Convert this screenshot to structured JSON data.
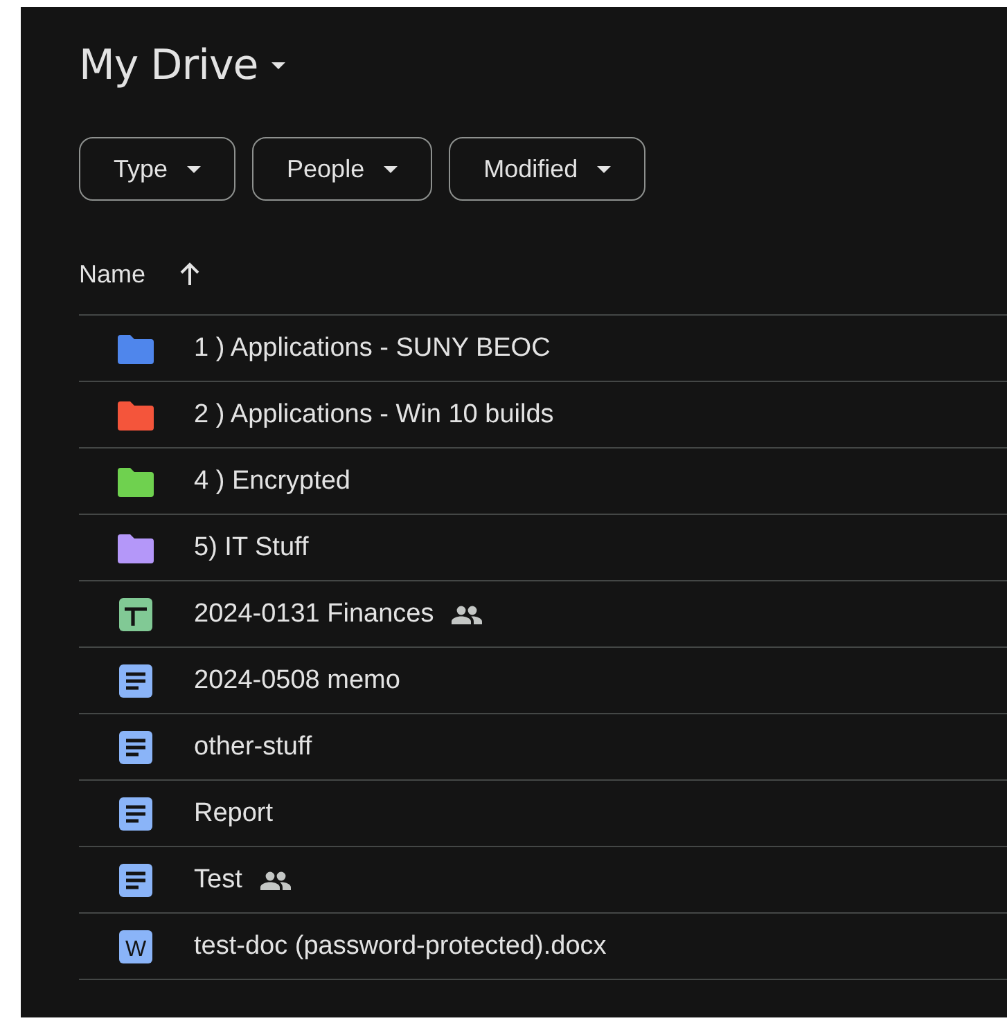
{
  "title": "My Drive",
  "filters": [
    {
      "label": "Type"
    },
    {
      "label": "People"
    },
    {
      "label": "Modified"
    }
  ],
  "table": {
    "columns": [
      {
        "label": "Name",
        "sort_ascending": true
      }
    ],
    "rows": [
      {
        "name": "1 ) Applications - SUNY BEOC",
        "kind": "folder",
        "color": "#4f86ec",
        "shared": false
      },
      {
        "name": "2 ) Applications - Win 10 builds",
        "kind": "folder",
        "color": "#f4553b",
        "shared": false
      },
      {
        "name": "4 ) Encrypted",
        "kind": "folder",
        "color": "#6fd14f",
        "shared": false
      },
      {
        "name": "5) IT Stuff",
        "kind": "folder",
        "color": "#b497f9",
        "shared": false
      },
      {
        "name": "2024-0131 Finances",
        "kind": "sheet",
        "shared": true
      },
      {
        "name": "2024-0508 memo",
        "kind": "doc",
        "shared": false
      },
      {
        "name": "other-stuff",
        "kind": "doc",
        "shared": false
      },
      {
        "name": "Report",
        "kind": "doc",
        "shared": false
      },
      {
        "name": "Test",
        "kind": "doc",
        "shared": true
      },
      {
        "name": "test-doc (password-protected).docx",
        "kind": "word",
        "badge": "W",
        "shared": false
      }
    ]
  }
}
